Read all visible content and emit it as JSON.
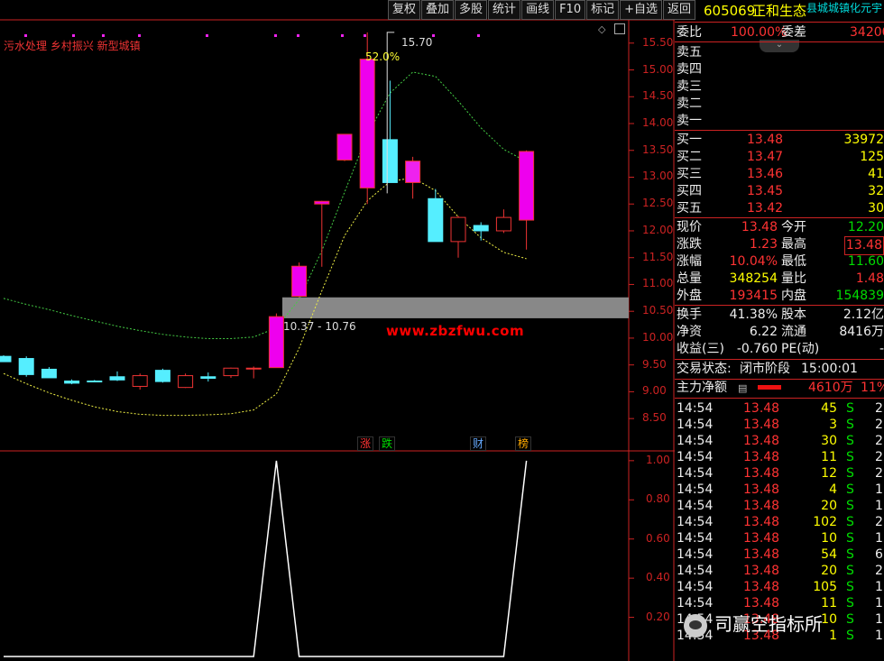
{
  "toolbar": [
    "复权",
    "叠加",
    "多股",
    "统计",
    "画线",
    "F10",
    "标记",
    "+自选",
    "返回"
  ],
  "tags": "污水处理 乡村振兴 新型城镇",
  "watermark": "www.zbzfwu.com",
  "annotations": {
    "max_price": "15.70",
    "max_pct": "52.0%",
    "range": "10.37 - 10.76"
  },
  "events": [
    {
      "label": "涨",
      "color": "#f33"
    },
    {
      "label": "跌",
      "color": "#0d0"
    },
    {
      "label": "财",
      "color": "#6af"
    },
    {
      "label": "榜",
      "color": "#fa0"
    }
  ],
  "price_axis": [
    "15.50",
    "15.00",
    "14.50",
    "14.00",
    "13.50",
    "13.00",
    "12.50",
    "12.00",
    "11.50",
    "11.00",
    "10.50",
    "10.00",
    "9.50",
    "9.00",
    "8.50"
  ],
  "indicator_axis": [
    "1.00",
    "0.80",
    "0.60",
    "0.40",
    "0.20"
  ],
  "chart_data": {
    "type": "candlestick",
    "ylim": [
      8.2,
      15.9
    ],
    "candles": [
      {
        "o": 9.66,
        "h": 9.68,
        "l": 9.58,
        "c": 9.56
      },
      {
        "o": 9.62,
        "h": 9.66,
        "l": 9.28,
        "c": 9.32
      },
      {
        "o": 9.42,
        "h": 9.46,
        "l": 9.26,
        "c": 9.26
      },
      {
        "o": 9.2,
        "h": 9.23,
        "l": 9.14,
        "c": 9.16
      },
      {
        "o": 9.2,
        "h": 9.22,
        "l": 9.18,
        "c": 9.19
      },
      {
        "o": 9.28,
        "h": 9.38,
        "l": 9.2,
        "c": 9.22
      },
      {
        "o": 9.1,
        "h": 9.34,
        "l": 9.04,
        "c": 9.3
      },
      {
        "o": 9.4,
        "h": 9.43,
        "l": 9.17,
        "c": 9.19
      },
      {
        "o": 9.08,
        "h": 9.34,
        "l": 9.07,
        "c": 9.3
      },
      {
        "o": 9.28,
        "h": 9.36,
        "l": 9.19,
        "c": 9.25
      },
      {
        "o": 9.3,
        "h": 9.45,
        "l": 9.26,
        "c": 9.44
      },
      {
        "o": 9.43,
        "h": 9.47,
        "l": 9.25,
        "c": 9.44
      },
      {
        "o": 9.45,
        "h": 10.46,
        "l": 9.45,
        "c": 10.4
      },
      {
        "o": 10.78,
        "h": 11.41,
        "l": 10.76,
        "c": 11.34
      },
      {
        "o": 12.5,
        "h": 12.56,
        "l": 11.33,
        "c": 12.55
      },
      {
        "o": 13.32,
        "h": 13.8,
        "l": 13.3,
        "c": 13.8
      },
      {
        "o": 12.8,
        "h": 15.7,
        "l": 12.5,
        "c": 15.2
      },
      {
        "o": 13.7,
        "h": 14.8,
        "l": 12.9,
        "c": 12.9
      },
      {
        "o": 12.9,
        "h": 13.38,
        "l": 12.6,
        "c": 13.3
      },
      {
        "o": 12.6,
        "h": 12.78,
        "l": 11.83,
        "c": 11.8
      },
      {
        "o": 11.8,
        "h": 12.28,
        "l": 11.5,
        "c": 12.25
      },
      {
        "o": 12.1,
        "h": 12.16,
        "l": 11.82,
        "c": 12.0
      },
      {
        "o": 12.0,
        "h": 12.4,
        "l": 11.96,
        "c": 12.25
      },
      {
        "o": 12.2,
        "h": 13.5,
        "l": 11.65,
        "c": 13.48
      }
    ],
    "band_upper": [
      10.74,
      10.63,
      10.53,
      10.42,
      10.32,
      10.22,
      10.14,
      10.07,
      10.02,
      9.99,
      9.99,
      10.02,
      10.19,
      10.72,
      11.63,
      12.72,
      13.79,
      14.57,
      14.96,
      14.88,
      14.42,
      13.92,
      13.52,
      13.29
    ],
    "band_lower": [
      9.34,
      9.15,
      8.98,
      8.84,
      8.72,
      8.63,
      8.58,
      8.56,
      8.56,
      8.57,
      8.59,
      8.66,
      8.96,
      9.81,
      10.88,
      11.91,
      12.56,
      12.92,
      12.99,
      12.75,
      12.26,
      11.87,
      11.6,
      11.48
    ],
    "indicator": [
      0,
      0,
      0,
      0,
      0,
      0,
      0,
      0,
      0,
      0,
      0,
      0,
      1,
      0,
      0,
      0,
      0,
      0,
      0,
      0,
      0,
      0,
      0,
      1
    ],
    "indicator_ylim": [
      0,
      1.05
    ],
    "zone": {
      "low": 10.37,
      "high": 10.76
    }
  },
  "stock": {
    "code": "605069",
    "name": "正和生态",
    "sector": "县城城镇化元宇"
  },
  "weibi": {
    "label": "委比",
    "value": "100.00%",
    "label2": "委差",
    "value2": "34200"
  },
  "sells": [
    "卖五",
    "卖四",
    "卖三",
    "卖二",
    "卖一"
  ],
  "buys": [
    {
      "label": "买一",
      "price": "13.48",
      "vol": "33972"
    },
    {
      "label": "买二",
      "price": "13.47",
      "vol": "125"
    },
    {
      "label": "买三",
      "price": "13.46",
      "vol": "41"
    },
    {
      "label": "买四",
      "price": "13.45",
      "vol": "32"
    },
    {
      "label": "买五",
      "price": "13.42",
      "vol": "30"
    }
  ],
  "quote": [
    {
      "l": "现价",
      "v": "13.48",
      "vc": "red",
      "l2": "今开",
      "v2": "12.20",
      "v2c": "green"
    },
    {
      "l": "涨跌",
      "v": "1.23",
      "vc": "red",
      "l2": "最高",
      "v2": "13.48",
      "v2c": "red"
    },
    {
      "l": "涨幅",
      "v": "10.04%",
      "vc": "red",
      "l2": "最低",
      "v2": "11.60",
      "v2c": "green"
    },
    {
      "l": "总量",
      "v": "348254",
      "vc": "yellow",
      "l2": "量比",
      "v2": "1.48",
      "v2c": "red"
    },
    {
      "l": "外盘",
      "v": "193415",
      "vc": "red",
      "l2": "内盘",
      "v2": "154839",
      "v2c": "green"
    }
  ],
  "stats": [
    {
      "l": "换手",
      "v": "41.38%",
      "l2": "股本",
      "v2": "2.12亿"
    },
    {
      "l": "净资",
      "v": "6.22",
      "l2": "流通",
      "v2": "8416万"
    },
    {
      "l": "收益(三)",
      "v": "-0.760",
      "l2": "PE(动)",
      "v2": "-"
    }
  ],
  "trade_status": {
    "label": "交易状态:",
    "value": "闭市阶段",
    "time": "15:00:01"
  },
  "main_force": {
    "label": "主力净额",
    "value": "4610万",
    "pct": "11%"
  },
  "ticks": [
    {
      "t": "14:54",
      "p": "13.48",
      "v": "45",
      "s": "S",
      "n": "2"
    },
    {
      "t": "14:54",
      "p": "13.48",
      "v": "3",
      "s": "S",
      "n": "2"
    },
    {
      "t": "14:54",
      "p": "13.48",
      "v": "30",
      "s": "S",
      "n": "2"
    },
    {
      "t": "14:54",
      "p": "13.48",
      "v": "11",
      "s": "S",
      "n": "2"
    },
    {
      "t": "14:54",
      "p": "13.48",
      "v": "12",
      "s": "S",
      "n": "2"
    },
    {
      "t": "14:54",
      "p": "13.48",
      "v": "4",
      "s": "S",
      "n": "1"
    },
    {
      "t": "14:54",
      "p": "13.48",
      "v": "20",
      "s": "S",
      "n": "1"
    },
    {
      "t": "14:54",
      "p": "13.48",
      "v": "102",
      "s": "S",
      "n": "2"
    },
    {
      "t": "14:54",
      "p": "13.48",
      "v": "10",
      "s": "S",
      "n": "1"
    },
    {
      "t": "14:54",
      "p": "13.48",
      "v": "54",
      "s": "S",
      "n": "6"
    },
    {
      "t": "14:54",
      "p": "13.48",
      "v": "20",
      "s": "S",
      "n": "2"
    },
    {
      "t": "14:54",
      "p": "13.48",
      "v": "105",
      "s": "S",
      "n": "1"
    },
    {
      "t": "14:54",
      "p": "13.48",
      "v": "11",
      "s": "S",
      "n": "1"
    },
    {
      "t": "14:54",
      "p": "13.48",
      "v": "10",
      "s": "S",
      "n": "1"
    },
    {
      "t": "14:54",
      "p": "13.48",
      "v": "1",
      "s": "S",
      "n": "1"
    }
  ],
  "footer": "司赢空指标所"
}
